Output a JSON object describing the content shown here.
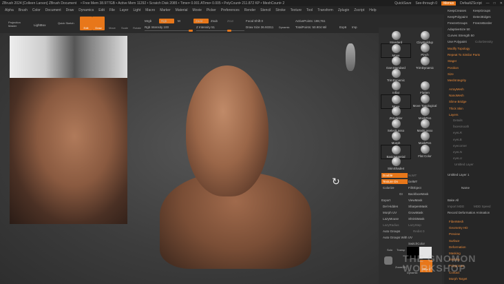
{
  "titlebar": {
    "title": "ZBrush 2024 [Colleen Larson]  ZBrush Document",
    "stats": "• Free Mem 38.977GB • Active Mem 11292 • Scratch Disk 2085 • Timer• 0.001 ATime• 0.005 • PolyCount• 211.872 KP • MeshCount• 2",
    "quicksave": "QuickSave",
    "seethrough": "See-through  0",
    "menus": "Menus",
    "script": "DefaultZScript"
  },
  "menubar": [
    "Alpha",
    "Brush",
    "Color",
    "Document",
    "Draw",
    "Dynamics",
    "Edit",
    "File",
    "Layer",
    "Light",
    "Macro",
    "Marker",
    "Material",
    "Movie",
    "Picker",
    "Preferences",
    "Render",
    "Stencil",
    "Stroke",
    "Texture",
    "Tool",
    "Transform",
    "Zplugin",
    "Zscript",
    "Help"
  ],
  "toolbar": {
    "projection_master": "Projection Master",
    "lightbox": "LightBox",
    "quick_sketch": "Quick Sketch",
    "edit": "Edit",
    "draw": "Draw",
    "move": "Move",
    "scale": "Scale",
    "rotate": "Rotate",
    "mrgb": "Mrgb",
    "rgb": "Rgb",
    "m": "M",
    "zadd": "Zadd",
    "zsub": "Zsub",
    "zcut": "Zcut",
    "rgb_intensity": "Rgb Intensity 100",
    "z_intensity": "Z Intensity 51",
    "focal_shift": "Focal Shift 0",
    "draw_size": "Draw Size 36.93311",
    "dynamic": "Dynamic",
    "active_points": "ActivePoints: 198,761",
    "total_points": "TotalPoints: 50.904 Mil",
    "exp": "Exp6",
    "imp": "Imp"
  },
  "brushes": [
    "Standard",
    "ClayBuildup",
    "Move",
    "Pinch",
    "DamStandard",
    "TrimDynamic",
    "TrimDynamic",
    "Inflat",
    "Flatten",
    "Move",
    "Move Topological",
    "ZModeler",
    "MaskPen",
    "SelectLasso",
    "MaskLasso",
    "Morph",
    "MaskPen",
    "BasicMaterial",
    "Flat Color",
    "SkinShade4"
  ],
  "brush_options": {
    "double": "Double",
    "texture_on": "Texture On",
    "colorize": "Colorize",
    "nomt": "NoMT",
    "delmt": "DelMT",
    "fillobject": "FillObject",
    "backfacemask": "BackfaceMask",
    "gi": "GI",
    "export": "Export",
    "viewmask": "ViewMask",
    "del_hidden": "Del Hidden",
    "sharpenmask": "SharpenMask",
    "morph_uv": "Morph UV",
    "growmask": "GrowMask",
    "lazymouse": "LazyMouse",
    "shrinkmask": "ShrinkMask",
    "lazyradius": "LazyRadius",
    "lazystep": "LazyStep",
    "redist": "Redist 0",
    "auto_groups": "Auto Groups",
    "auto_groups_uv": "Auto Groups With UV",
    "switchcolor": "SwitchColor",
    "solo": "Solo",
    "transp": "Transp",
    "zoom2d": "Zoom2D",
    "dynamic": "Dynamic",
    "spix": "SPix 3"
  },
  "right_panel": {
    "top_items": [
      "KeepCreases",
      "KeepGroups",
      "KeepPolypaint",
      "DetectEdges",
      "FreezeGroups",
      "FreezeBorder"
    ],
    "adaptive_size": "AdaptiveSize 50",
    "curves_strength": "Curves Strength 50",
    "use_polypaint": "Use Polypaint",
    "color_density": "ColorDensity",
    "sub_items": [
      "Modify Topology",
      "Repeat To Similar Parts",
      "Stager",
      "Position",
      "Size",
      "MeshIntegrity"
    ],
    "mid_items": [
      "ArrayMesh",
      "NanoMesh",
      "Slime Bridge",
      "Thick Skin"
    ],
    "layers": "Layers",
    "layer_names": [
      "Details",
      "facesmooth",
      "eyeLR",
      "eyeLB",
      "eyecorner",
      "eyeLN",
      "eyeLU"
    ],
    "untitled_layer_box": "Untitled Layer",
    "untitled_layer": "Untitled Layer 1",
    "name": "Name",
    "bake_all": "Bake All",
    "import_mdd": "Import MDD",
    "mdd_speed": "MDD Speed",
    "record_anim": "Record Deformation Animation",
    "bottom_items": [
      "FiberMesh",
      "Geometry HD",
      "Preview",
      "Surface",
      "Deformation",
      "Masking",
      "Visibility",
      "Polygroups",
      "Contact",
      "Morph Target"
    ]
  },
  "watermark": "THE GNOMON WORKSHOP",
  "colors": {
    "accent": "#e8771a",
    "bg": "#2b2b2b"
  }
}
